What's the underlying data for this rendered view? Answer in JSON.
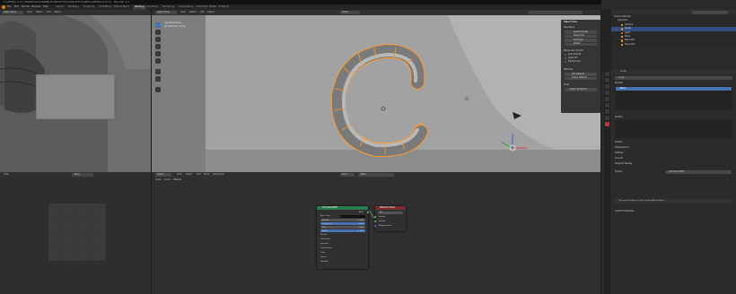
{
  "titlebar": {
    "title": "* [ARTERA 2 (C:\\TRABALHO\\DRIBBLE\\UNSUSTOV\\UNSUSTOV\\JPEG\\ARTERA.blend] - Blender 4.0"
  },
  "menubar": {
    "items": [
      "File",
      "Edit",
      "Render",
      "Window",
      "Help"
    ],
    "workspaces": [
      "Layout",
      "Modeling",
      "Sculpting",
      "UV Editing",
      "Texture Paint",
      "Shading",
      "Animation",
      "Rendering",
      "Compositing",
      "Geometry Nodes",
      "Scripting"
    ],
    "active_workspace": "Shading",
    "scene": "Scene",
    "view_layer": "ViewLayer"
  },
  "viewport": {
    "mode": "Object Mode",
    "view_menu": "View",
    "select_menu": "Select",
    "add_menu": "Add",
    "object_menu": "Object",
    "overlay_text_1": "User Perspective",
    "overlay_text_2": "(1) Collection | Curve",
    "transform": "Global"
  },
  "npanel": {
    "title": "Object Tools",
    "section_1": "Operations",
    "buttons_1": [
      "Shade Smooth",
      "Shade Flat",
      "Set Origin",
      "Delete"
    ],
    "section_2": "Shade Auto Smooth",
    "checks": [
      "Auto Smooth",
      "Angle 30°",
      "Flip Normals"
    ],
    "section_3": "Materials",
    "buttons_2": [
      "Add Material",
      "Assign Material"
    ],
    "section_4": "Mode",
    "button_3": "Apply Transforms"
  },
  "outliner": {
    "header": "Scene Collection",
    "rows": [
      "Collection",
      "Camera",
      "Curve",
      "Light",
      "Plane",
      "Plane.001",
      "Plane.002"
    ],
    "selected_index": 2
  },
  "properties": {
    "object_name": "Curve",
    "material_slot": "Curve",
    "material_name": "Black",
    "sections": [
      "Preview",
      "Surface",
      "Volume",
      "Displacement",
      "Settings",
      "Line Art",
      "Viewport Display",
      "Custom Properties"
    ],
    "shader_label": "Surface",
    "shader_value": "Principled BSDF",
    "notice": "This selected object is not a TexturedMesh object"
  },
  "node_editor": {
    "header_mode": "Object",
    "header_items": [
      "View",
      "Select",
      "Add",
      "Node",
      "Use Nodes"
    ],
    "slot": "Slot 1",
    "material": "Black",
    "breadcrumb": [
      "Curve",
      "Curve",
      "Material"
    ],
    "bsdf": {
      "title": "Principled BSDF",
      "rows": [
        "BSDF",
        "Base Color",
        "Metallic",
        "Roughness",
        "IOR",
        "Alpha",
        "Normal",
        "Subsurface",
        "Specular",
        "Transmission",
        "Coat",
        "Sheen",
        "Emission"
      ],
      "values": {
        "Metallic": "0.000",
        "Roughness": "0.500",
        "IOR": "1.450",
        "Alpha": "1.000"
      }
    },
    "output": {
      "title": "Material Output",
      "target": "All",
      "rows": [
        "Surface",
        "Volume",
        "Displacement"
      ]
    }
  },
  "uv_editor": {
    "mode": "View",
    "image": "Black"
  },
  "colors": {
    "selection_orange": "#ff9a2e",
    "bsdf_header": "#2b7a52",
    "output_header": "#7a2b2b",
    "accent_blue": "#4772b3",
    "outliner_selected": "#334d80"
  }
}
